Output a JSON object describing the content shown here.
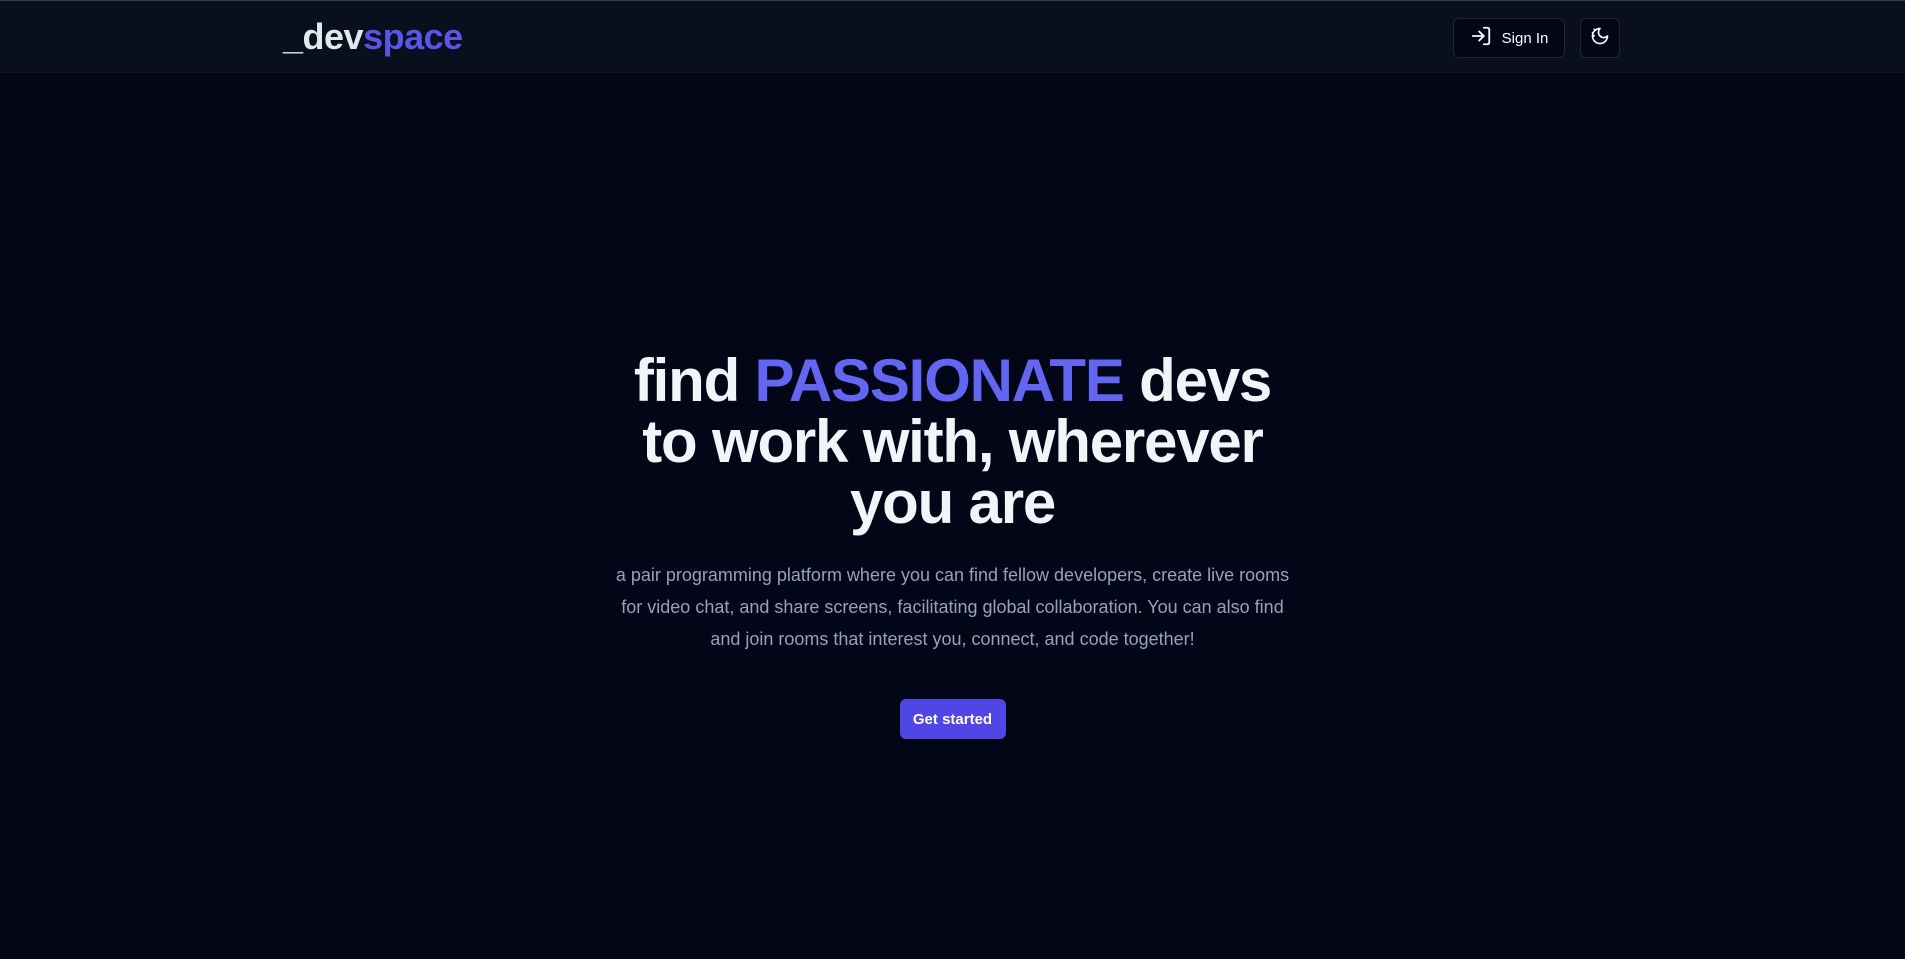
{
  "header": {
    "logo_prefix": "_dev",
    "logo_suffix": "space",
    "signin_label": "Sign In",
    "signin_icon": "log-in-icon",
    "theme_icon": "moon-sun-icon"
  },
  "hero": {
    "title_part1": "find ",
    "title_accent": "PASSIONATE",
    "title_part2": " devs to work with, wherever you are",
    "description": "a pair programming platform where you can find fellow developers, create live rooms for video chat, and share screens, facilitating global collaboration. You can also find and join rooms that interest you, connect, and code together!",
    "cta_label": "Get started"
  },
  "colors": {
    "background": "#030617",
    "navbar": "#0a0f1e",
    "accent": "#4f46e5",
    "accent_text": "#6366f1",
    "muted_text": "#94a3b8"
  }
}
